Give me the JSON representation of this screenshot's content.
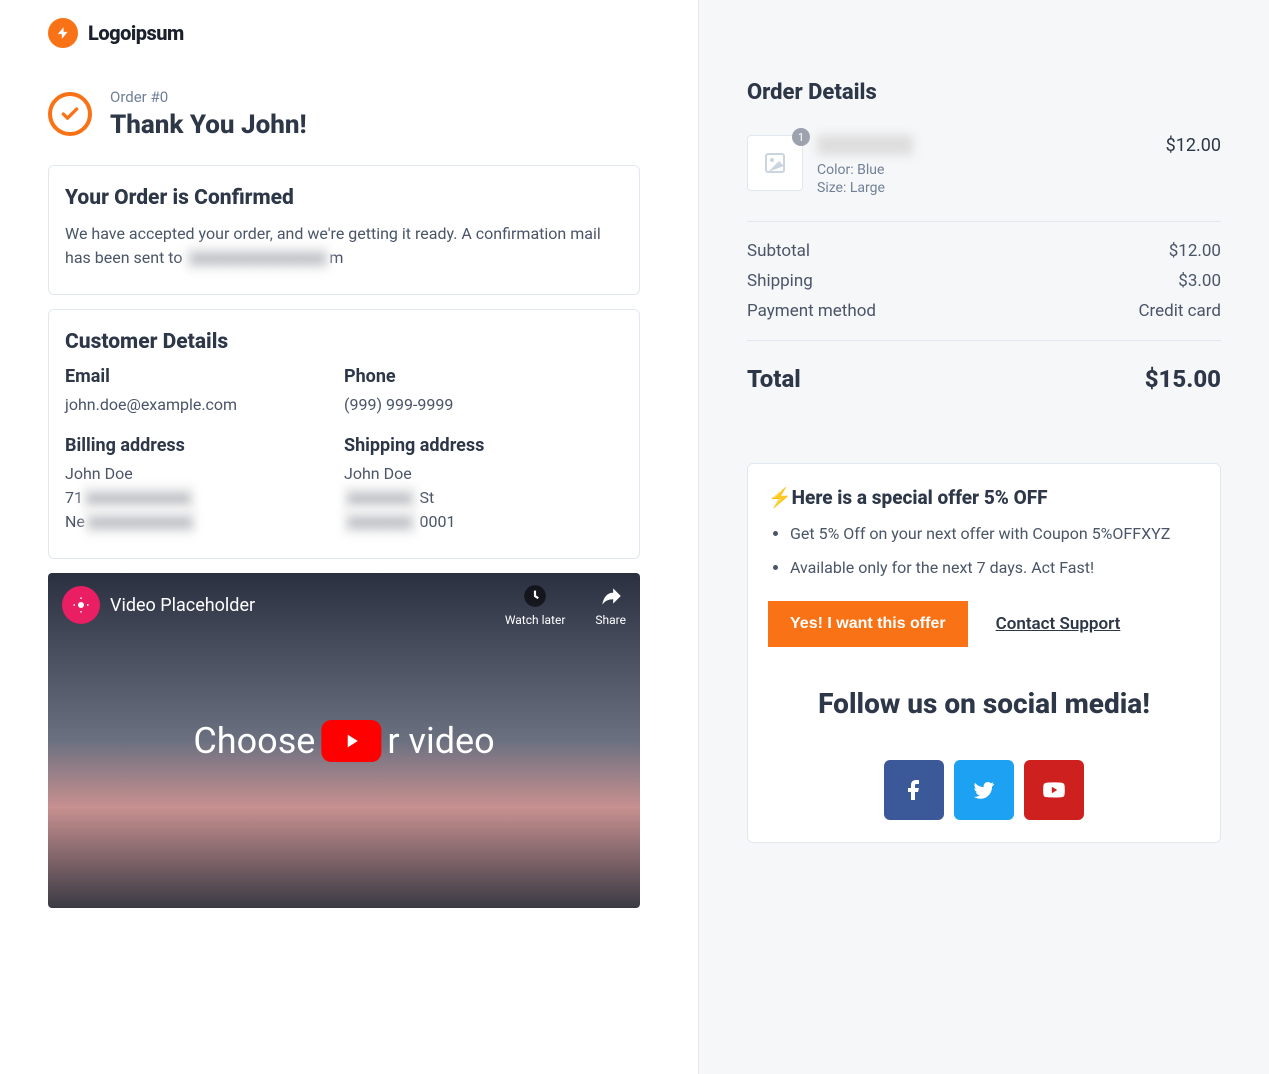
{
  "logo": {
    "text": "Logoipsum"
  },
  "header": {
    "order_label": "Order #0",
    "thanks": "Thank You John!"
  },
  "confirm_card": {
    "title": "Your Order is Confirmed",
    "body_pre": "We have accepted your order, and we're getting it ready. A confirmation mail has been sent to ",
    "body_blur": "xxxxxxxxxxxxxxxxx",
    "body_post": "m"
  },
  "customer": {
    "title": "Customer Details",
    "email_label": "Email",
    "email_value": "john.doe@example.com",
    "phone_label": "Phone",
    "phone_value": "(999) 999-9999",
    "billing_label": "Billing address",
    "billing_line1": "John Doe",
    "billing_line2_pre": "71",
    "billing_line2_blur": "xxxxxxxxxxxxx",
    "billing_line3_pre": "Ne",
    "billing_line3_blur": "xxxxxxxxxxxxx",
    "shipping_label": "Shipping address",
    "shipping_line1": "John Doe",
    "shipping_line2_blur": "xxxxxxxx",
    "shipping_line2_post": " St",
    "shipping_line3_blur": "xxxxxxxx",
    "shipping_line3_post": " 0001"
  },
  "video": {
    "title": "Video Placeholder",
    "watch_later": "Watch later",
    "share": "Share",
    "overlay_pre": "Choose ",
    "overlay_post": "r video"
  },
  "order_details": {
    "title": "Order Details",
    "item": {
      "qty": "1",
      "variant_color": "Color: Blue",
      "variant_size": "Size: Large",
      "price": "$12.00"
    },
    "subtotal_label": "Subtotal",
    "subtotal_value": "$12.00",
    "shipping_label": "Shipping",
    "shipping_value": "$3.00",
    "payment_label": "Payment method",
    "payment_value": "Credit card",
    "total_label": "Total",
    "total_value": "$15.00"
  },
  "offer": {
    "title": "⚡Here is a special offer 5% OFF",
    "bullet1": "Get 5% Off on your next offer with Coupon 5%OFFXYZ",
    "bullet2": "Available only for the next 7 days. Act Fast!",
    "cta": "Yes! I want this offer",
    "support": "Contact Support"
  },
  "social": {
    "heading": "Follow us on social media!"
  }
}
